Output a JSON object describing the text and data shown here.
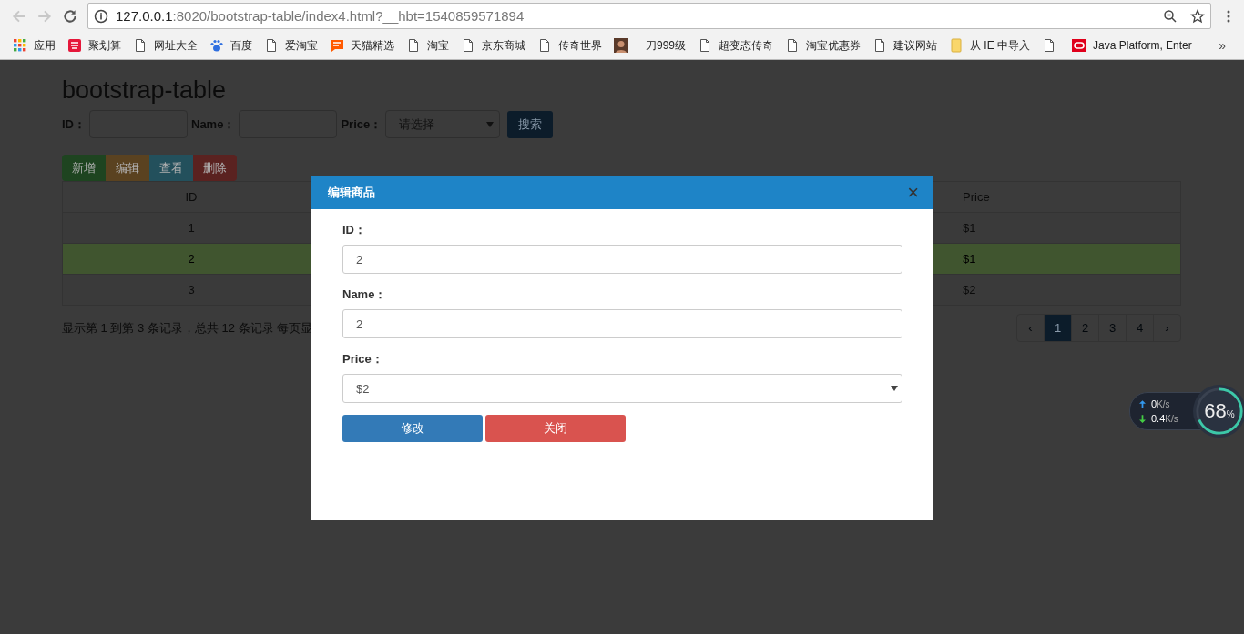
{
  "browser": {
    "url_host": "127.0.0.1",
    "url_rest": ":8020/bootstrap-table/index4.html?__hbt=1540859571894",
    "bookmarks": [
      {
        "label": "应用"
      },
      {
        "label": "聚划算"
      },
      {
        "label": "网址大全"
      },
      {
        "label": "百度"
      },
      {
        "label": "爱淘宝"
      },
      {
        "label": "天猫精选"
      },
      {
        "label": "淘宝"
      },
      {
        "label": "京东商城"
      },
      {
        "label": "传奇世界"
      },
      {
        "label": "一刀999级"
      },
      {
        "label": "超变态传奇"
      },
      {
        "label": "淘宝优惠券"
      },
      {
        "label": "建议网站"
      },
      {
        "label": "从 IE 中导入"
      },
      {
        "kind": "icon"
      },
      {
        "label": "Java Platform, Enter"
      }
    ],
    "more": "»"
  },
  "page": {
    "title": "bootstrap-table",
    "search": [
      {
        "label": "ID：",
        "kind": "input"
      },
      {
        "label": "Name：",
        "kind": "input"
      },
      {
        "label": "Price：",
        "kind": "select",
        "placeholder": "请选择"
      }
    ],
    "search_button": "搜索",
    "toolbar": [
      {
        "label": "新增",
        "color": "#1e4420"
      },
      {
        "label": "编辑",
        "color": "#5a4220"
      },
      {
        "label": "查看",
        "color": "#23505c"
      },
      {
        "label": "删除",
        "color": "#5a2220"
      }
    ],
    "table": {
      "columns": [
        "ID",
        "Price"
      ],
      "rows": [
        {
          "id": "1",
          "price": "$1",
          "selected": false
        },
        {
          "id": "2",
          "price": "$1",
          "selected": true
        },
        {
          "id": "3",
          "price": "$2",
          "selected": false
        }
      ]
    },
    "summary": "显示第 1 到第 3 条记录，总共 12 条记录 每页显",
    "pagination": [
      {
        "label": "‹",
        "selected": false
      },
      {
        "label": "1",
        "selected": true
      },
      {
        "label": "2",
        "selected": false
      },
      {
        "label": "3",
        "selected": false
      },
      {
        "label": "4",
        "selected": false
      },
      {
        "label": "›",
        "selected": false
      }
    ]
  },
  "modal": {
    "title": "编辑商品",
    "close": "×",
    "fields": [
      {
        "label": "ID：",
        "kind": "input",
        "value": "2"
      },
      {
        "label": "Name：",
        "kind": "input",
        "value": "2"
      },
      {
        "label": "Price：",
        "kind": "select",
        "value": "$2"
      }
    ],
    "buttons": [
      {
        "label": "修改",
        "kind": "primary"
      },
      {
        "label": "关闭",
        "kind": "danger"
      }
    ]
  },
  "widget": {
    "up": "0",
    "down": "0.4",
    "unit_up": "K/s",
    "unit_down": "K/s",
    "percent": "68",
    "percent_sign": "%"
  }
}
